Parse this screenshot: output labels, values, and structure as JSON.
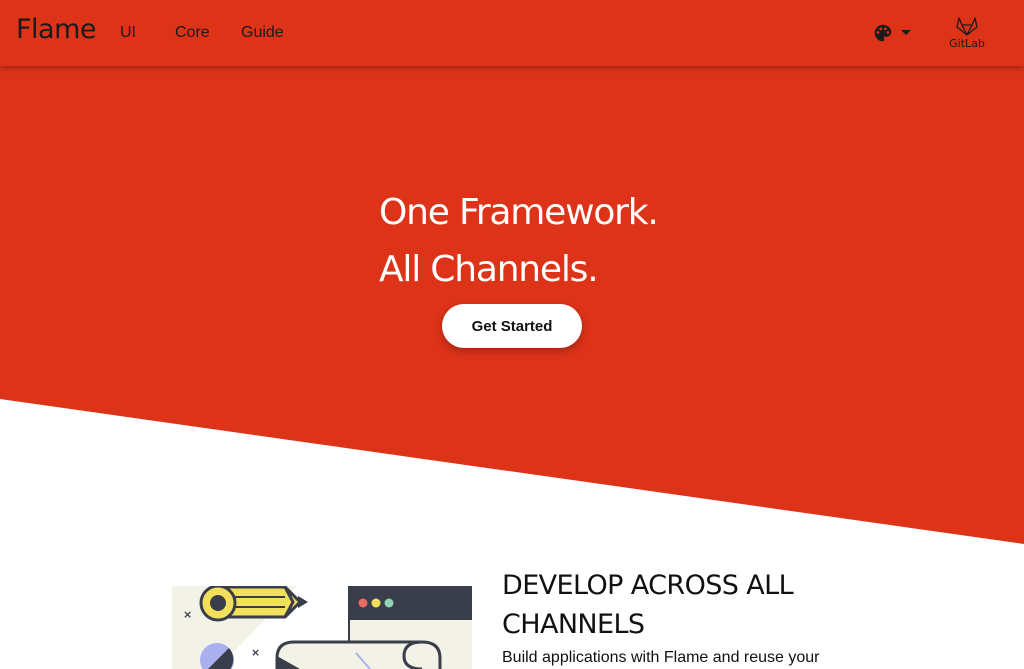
{
  "colors": {
    "brand": "#dd3319",
    "nav_text": "#1b1b1b",
    "hero_text": "#ffffff",
    "button_bg": "#ffffff",
    "body_text": "#111111",
    "illustration_yellow": "#f2e05c",
    "illustration_dark": "#3a3d4a",
    "illustration_cream": "#f2f3e6",
    "illustration_lavender": "#aab0ee"
  },
  "navbar": {
    "brand": "Flame",
    "links": [
      "UI",
      "Core",
      "Guide"
    ],
    "theme_icon": "palette-icon",
    "gitlab": {
      "icon": "gitlab-icon",
      "label": "GitLab"
    }
  },
  "hero": {
    "title_lines": [
      "One Framework.",
      "All Channels."
    ],
    "cta_label": "Get Started"
  },
  "feature": {
    "heading": "DEVELOP ACROSS ALL CHANNELS",
    "text": "Build applications with Flame and reuse your",
    "illustration_icons": [
      "pencil-icon",
      "browser-window-icon",
      "envelope-icon"
    ]
  }
}
